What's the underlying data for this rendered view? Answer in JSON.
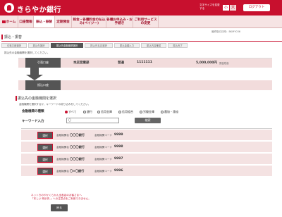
{
  "header": {
    "bank_name": "きらやか銀行",
    "fontsize_label": "文字サイズを変更する",
    "font_small": "小",
    "font_large": "大",
    "logout": "ログアウト"
  },
  "nav": {
    "home": "ホーム",
    "balance": "口座情報",
    "transfer": "振込・振替",
    "periodic": "定期預金",
    "tax": "税金・各種料金の払込み(ペイジー)",
    "pay": "各種お申込み・お手続き",
    "change": "ご利用サービスの変更"
  },
  "datetime": "最終取引日時：BKMY036",
  "page_title": "振込・振替",
  "steps": [
    "引落口座選択",
    "振込先選択",
    "振込先金融機関選択",
    "振込先支店選択",
    "振込金額入力",
    "振込内容確認",
    "振込完了"
  ],
  "instruction": "振込先の金融機関を選択してください。",
  "from_account": {
    "label": "引落口座",
    "branch": "本店営業部",
    "type": "普通",
    "number": "1111111",
    "balance": "5,000,000円",
    "balance_label": "預金残高"
  },
  "to_account": {
    "label": "振込口座"
  },
  "bank_select": {
    "title": "振込先の金融機関を選択",
    "desc": "金融機関を選択するか、キーワードの絞り込みをしてください。",
    "type_label": "金融機関の種類",
    "radios": [
      "すべて",
      "銀行",
      "信用金庫",
      "信用組合",
      "労働金庫",
      "農協・漁協"
    ],
    "keyword_label": "キーワード入力",
    "keyword_value": "〇",
    "search_button": "検索"
  },
  "results": [
    {
      "select": "選択",
      "name_label": "金融機関名",
      "name": "〇〇〇銀行",
      "code_label": "金融機関コード",
      "code": "9999"
    },
    {
      "select": "選択",
      "name_label": "金融機関名",
      "name": "〇〇〇銀行",
      "code_label": "金融機関コード",
      "code": "9998"
    },
    {
      "select": "選択",
      "name_label": "金融機関名",
      "name": "〇〇〇銀行",
      "code_label": "金融機関コード",
      "code": "9997"
    },
    {
      "select": "選択",
      "name_label": "金融機関名",
      "name": "〇×〇銀行",
      "code_label": "金融機関コード",
      "code": "9996"
    }
  ],
  "notice_line1": "ネットきのやかくらかん全各店のお客さまへ",
  "notice_line2": "「本しい 明示先 」への注意点をご利用できません。",
  "back_button": "戻る",
  "colors": {
    "accent": "#c8102e",
    "row_bg": "#f4e2e2",
    "dark": "#555555"
  }
}
